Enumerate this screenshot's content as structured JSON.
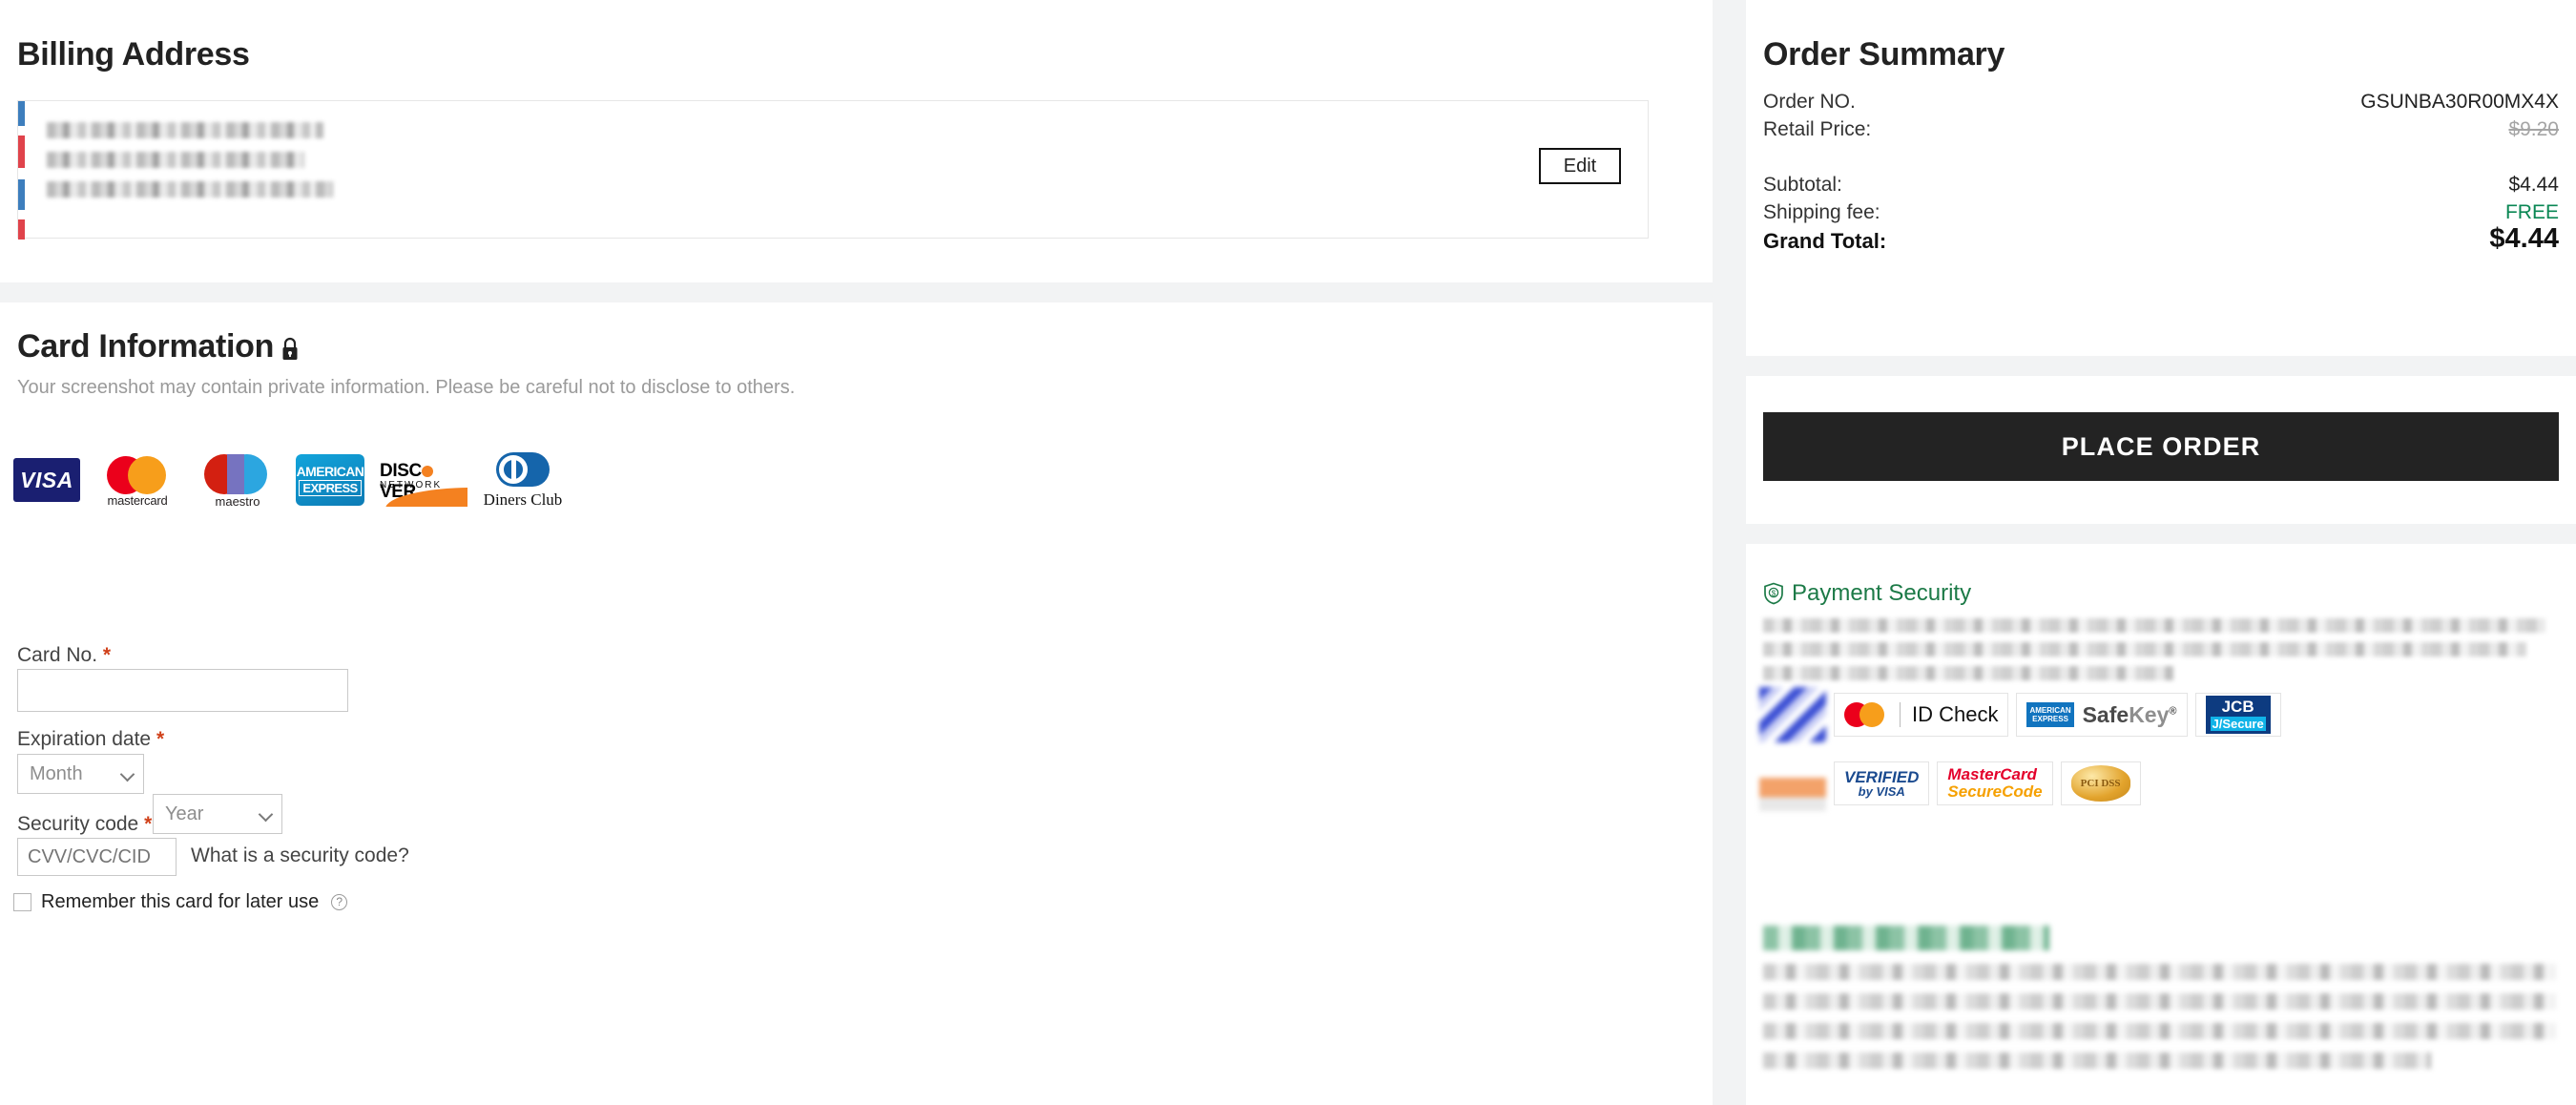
{
  "billing": {
    "title": "Billing Address",
    "edit_label": "Edit",
    "address_redacted": true
  },
  "card": {
    "title": "Card Information",
    "lock_icon": "lock-icon",
    "note": "Your screenshot may contain private information. Please be careful not to disclose to others.",
    "brands": [
      {
        "name": "visa",
        "label": "VISA"
      },
      {
        "name": "mastercard",
        "label": "mastercard"
      },
      {
        "name": "maestro",
        "label": "maestro"
      },
      {
        "name": "american-express",
        "line1": "AMERICAN",
        "line2": "EXPRESS"
      },
      {
        "name": "discover",
        "label": "DISC VER",
        "sub": "NETWORK"
      },
      {
        "name": "diners-club",
        "label": "Diners Club"
      }
    ],
    "card_no_label": "Card No.",
    "card_no_value": "",
    "card_no_placeholder": "",
    "expiration_label": "Expiration date",
    "month_value": "Month",
    "year_value": "Year",
    "security_code_label": "Security code",
    "security_code_placeholder": "CVV/CVC/CID",
    "security_code_help": "What is a security code?",
    "remember_label": "Remember this card for later use",
    "remember_checked": false,
    "required_mark": "*"
  },
  "summary": {
    "title": "Order Summary",
    "rows": [
      {
        "label": "Order NO.",
        "value": "GSUNBA30R00MX4X"
      },
      {
        "label": "Retail Price:",
        "value": "$9.20"
      },
      {
        "label": "Subtotal:",
        "value": "$4.44"
      },
      {
        "label": "Shipping fee:",
        "value": "FREE"
      },
      {
        "label": "Grand Total:",
        "value": "$4.44"
      }
    ]
  },
  "place_order": {
    "label": "PLACE ORDER"
  },
  "security": {
    "title": "Payment Security",
    "shield_icon": "shield-dollar-icon",
    "badges_row1": [
      {
        "name": "verified-by-visa-blurred"
      },
      {
        "name": "mastercard-id-check",
        "label": "ID Check"
      },
      {
        "name": "amex-safekey",
        "mini1": "AMERICAN",
        "mini2": "EXPRESS",
        "label": "SafeKey",
        "reg": "®"
      },
      {
        "name": "jcb-j-secure",
        "label": "JCB",
        "sub": "J/Secure"
      }
    ],
    "badges_row2": [
      {
        "name": "discover-protectbuy-blurred"
      },
      {
        "name": "verified-by-visa",
        "label": "VERIFIED",
        "sub": "by VISA"
      },
      {
        "name": "mastercard-securecode",
        "label": "MasterCard",
        "sub": "SecureCode"
      },
      {
        "name": "pci-dss-compliant",
        "label": "PCI DSS"
      }
    ]
  },
  "privacy": {
    "title_redacted": true,
    "body_redacted": true
  },
  "colors": {
    "accent_green": "#1c7a47",
    "free_green": "#0a8754",
    "required_orange": "#d0411a",
    "place_order_bg": "#232323",
    "page_bg": "#f2f3f4"
  }
}
